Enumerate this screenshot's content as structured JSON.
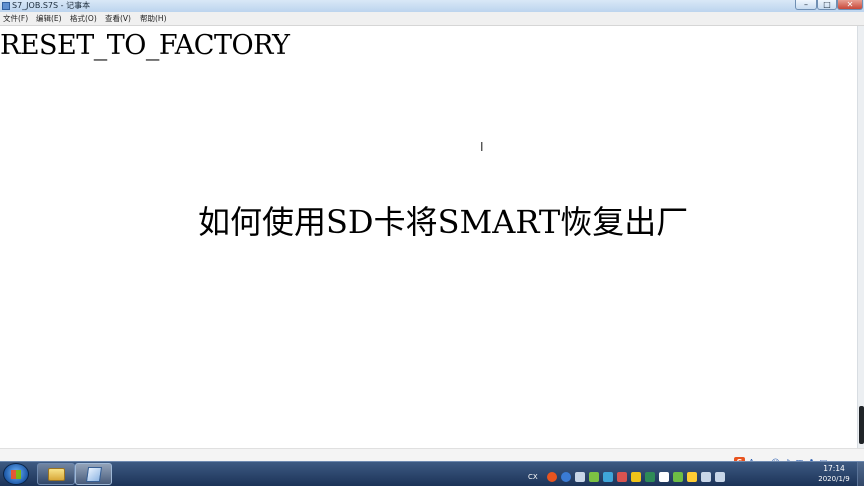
{
  "window": {
    "title": "S7_JOB.S7S - 记事本",
    "controls": {
      "minimize": "–",
      "maximize": "□",
      "close": "✕"
    }
  },
  "menu": [
    {
      "label": "文件(F)"
    },
    {
      "label": "编辑(E)"
    },
    {
      "label": "格式(O)"
    },
    {
      "label": "查看(V)"
    },
    {
      "label": "帮助(H)"
    }
  ],
  "editor": {
    "line1": "RESET_TO_FACTORY",
    "line2": "如何使用SD卡将SMART恢复出厂",
    "cursor_glyph": "I"
  },
  "ime_bar": {
    "brand": "S",
    "icons": [
      "ime-sogou-icon",
      "ime-font-icon",
      "ime-punct-icon",
      "ime-emoji-icon",
      "ime-mic-icon",
      "ime-keyboard-icon",
      "ime-skin-icon",
      "ime-toolbox-icon"
    ],
    "labels": [
      "S",
      "A",
      "·,",
      "☺",
      "♪",
      "▦",
      "♣",
      "▤"
    ]
  },
  "taskbar": {
    "tray_language": "CX",
    "tray_icons": [
      "sogou-tray-icon",
      "help-tray-icon",
      "arrow-tray-icon",
      "app-tray-icon-1",
      "app-tray-icon-2",
      "app-tray-icon-3",
      "app-tray-icon-4",
      "app-tray-icon-5",
      "app-tray-icon-6",
      "wechat-tray-icon",
      "app-tray-icon-7",
      "network-tray-icon",
      "volume-tray-icon"
    ],
    "tray_colors": [
      "#e8541f",
      "#3a7bd5",
      "#c8d6e8",
      "#7cc242",
      "#3fa6d9",
      "#d9534f",
      "#f0c419",
      "#2e8b57",
      "#ffffff",
      "#6dbd45",
      "#ffcc33",
      "#c8d6e8",
      "#c8d6e8"
    ],
    "clock_time": "17:14",
    "clock_date": "2020/1/9"
  }
}
